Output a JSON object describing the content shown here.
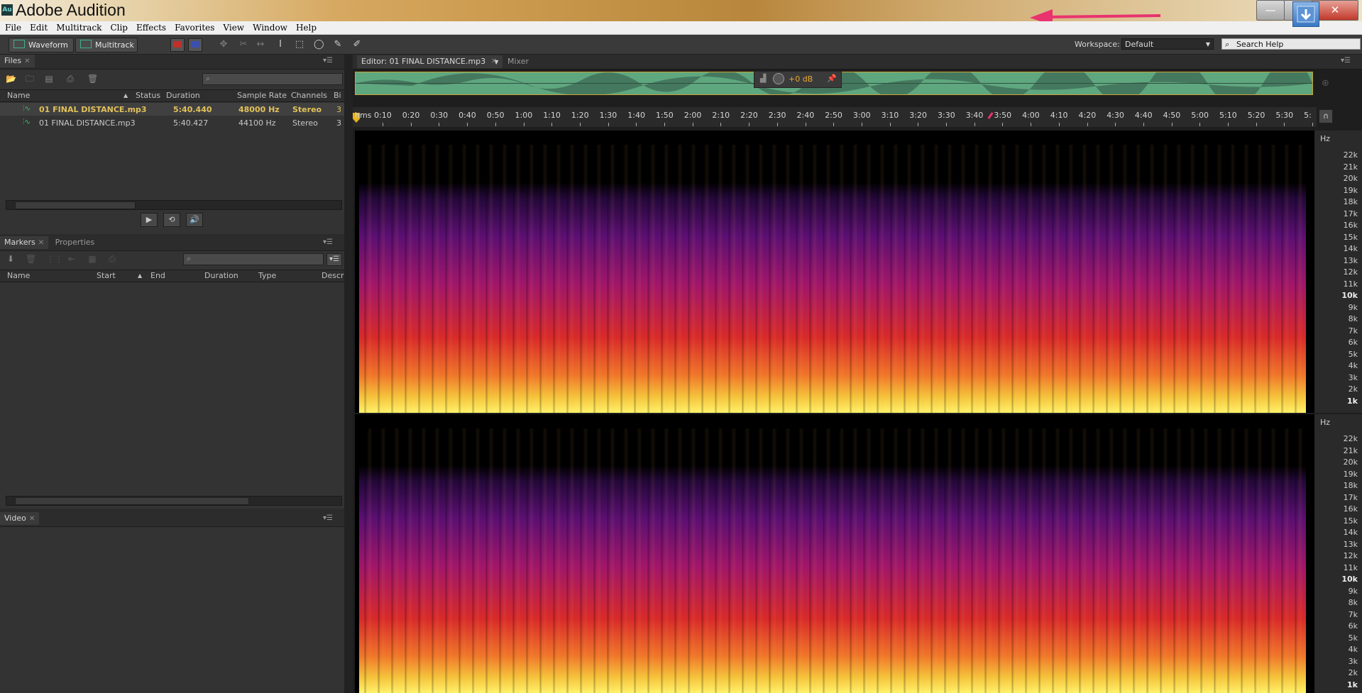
{
  "window": {
    "title": "Adobe Audition",
    "logo": "Au",
    "buttons": {
      "minimize": "—",
      "maximize": "❐",
      "close": "✕"
    }
  },
  "menu": [
    "File",
    "Edit",
    "Multitrack",
    "Clip",
    "Effects",
    "Favorites",
    "View",
    "Window",
    "Help"
  ],
  "toolbar": {
    "waveform": "Waveform",
    "multitrack": "Multitrack",
    "workspace_label": "Workspace:",
    "workspace_value": "Default",
    "search_help": "Search Help"
  },
  "files_panel": {
    "tab": "Files",
    "columns": [
      "Name",
      "Status",
      "Duration",
      "Sample Rate",
      "Channels",
      "Bi"
    ],
    "rows": [
      {
        "name": "01 FINAL DISTANCE.mp3",
        "status": "",
        "duration": "5:40.440",
        "sample_rate": "48000 Hz",
        "channels": "Stereo",
        "bits": "3",
        "selected": true
      },
      {
        "name": "01 FINAL DISTANCE.mp3",
        "status": "",
        "duration": "5:40.427",
        "sample_rate": "44100 Hz",
        "channels": "Stereo",
        "bits": "3",
        "selected": false
      }
    ]
  },
  "markers_panel": {
    "tabs": [
      "Markers",
      "Properties"
    ],
    "columns": [
      "Name",
      "Start",
      "End",
      "Duration",
      "Type",
      "Descr"
    ]
  },
  "video_panel": {
    "tab": "Video"
  },
  "editor": {
    "tab": "Editor: 01 FINAL DISTANCE.mp3",
    "mixer_tab": "Mixer",
    "hud_gain": "+0 dB",
    "time_unit": "hms",
    "ticks": [
      "0:10",
      "0:20",
      "0:30",
      "0:40",
      "0:50",
      "1:00",
      "1:10",
      "1:20",
      "1:30",
      "1:40",
      "1:50",
      "2:00",
      "2:10",
      "2:20",
      "2:30",
      "2:40",
      "2:50",
      "3:00",
      "3:10",
      "3:20",
      "3:30",
      "3:40",
      "3:50",
      "4:00",
      "4:10",
      "4:20",
      "4:30",
      "4:40",
      "4:50",
      "5:00",
      "5:10",
      "5:20",
      "5:30",
      "5:"
    ],
    "hz_unit": "Hz",
    "hz_labels": [
      "22k",
      "21k",
      "20k",
      "19k",
      "18k",
      "17k",
      "16k",
      "15k",
      "14k",
      "13k",
      "12k",
      "11k",
      "10k",
      "9k",
      "8k",
      "7k",
      "6k",
      "5k",
      "4k",
      "3k",
      "2k",
      "1k"
    ],
    "hz_major": [
      "10k",
      "1k"
    ]
  },
  "colors": {
    "annotation_arrow": "#e8336e",
    "panel_bg": "#333333",
    "overview_wave": "#5fa77f",
    "selected_file_text": "#e2c15a"
  }
}
